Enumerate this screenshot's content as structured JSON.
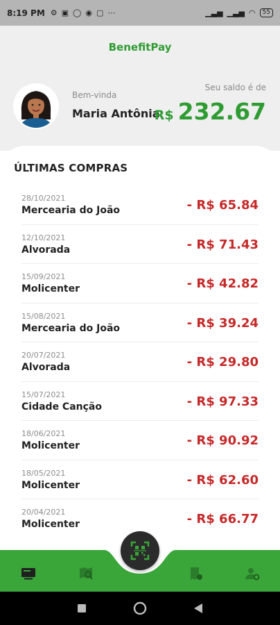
{
  "status_bar": {
    "time": "8:19 PM",
    "notification_icons": [
      "settings-icon",
      "mail-icon",
      "whatsapp-icon",
      "chat-icon",
      "app-icon",
      "more-icon"
    ],
    "battery": "55"
  },
  "app": {
    "brand": "BenefitPay"
  },
  "user": {
    "welcome": "Bem-vinda",
    "name": "Maria Antônia"
  },
  "balance": {
    "label": "Seu saldo é de",
    "currency": "R$",
    "value": "232.67"
  },
  "purchases": {
    "title": "ÚLTIMAS COMPRAS",
    "items": [
      {
        "date": "28/10/2021",
        "store": "Mercearia do João",
        "amount": "- R$ 65.84"
      },
      {
        "date": "12/10/2021",
        "store": "Alvorada",
        "amount": "- R$ 71.43"
      },
      {
        "date": "15/09/2021",
        "store": "Molicenter",
        "amount": "- R$ 42.82"
      },
      {
        "date": "15/08/2021",
        "store": "Mercearia do João",
        "amount": "- R$ 39.24"
      },
      {
        "date": "20/07/2021",
        "store": "Alvorada",
        "amount": "- R$ 29.80"
      },
      {
        "date": "15/07/2021",
        "store": "Cidade Canção",
        "amount": "- R$ 97.33"
      },
      {
        "date": "18/06/2021",
        "store": "Molicenter",
        "amount": "- R$ 90.92"
      },
      {
        "date": "18/05/2021",
        "store": "Molicenter",
        "amount": "- R$ 62.60"
      },
      {
        "date": "20/04/2021",
        "store": "Molicenter",
        "amount": "- R$ 66.77"
      }
    ]
  },
  "bottom_nav": {
    "items": [
      "wallet-icon",
      "map-search-icon",
      "qr-scan-icon",
      "receipt-icon",
      "user-settings-icon"
    ],
    "active": "wallet-icon"
  },
  "colors": {
    "brand_green": "#2f9c33",
    "negative_red": "#c62828",
    "header_bg": "#efefef"
  }
}
